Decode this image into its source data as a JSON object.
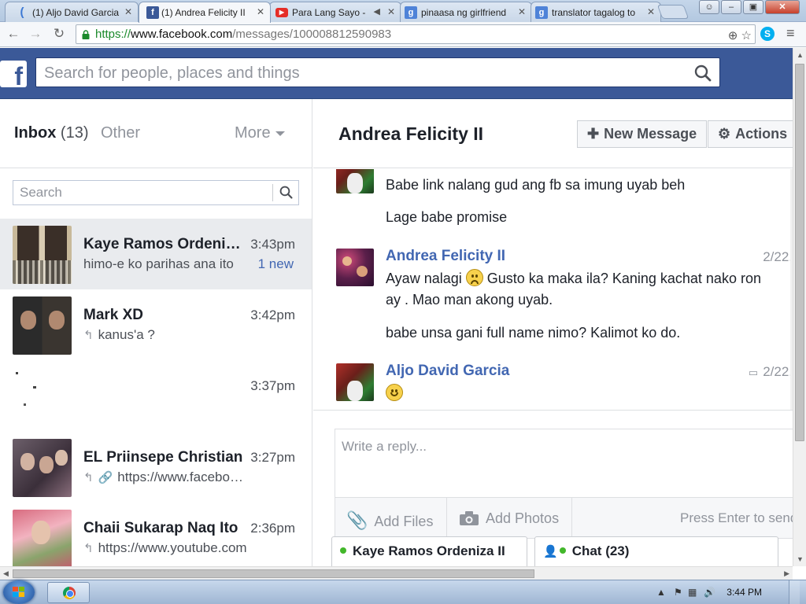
{
  "browser": {
    "tabs": [
      {
        "title": "(1) Aljo David Garcia",
        "favicon": "loading-icon",
        "active": false
      },
      {
        "title": "(1) Andrea Felicity II",
        "favicon": "facebook-icon",
        "active": true
      },
      {
        "title": "Para Lang Sayo - ",
        "favicon": "youtube-icon",
        "active": false
      },
      {
        "title": "pinaasa ng girlfriend",
        "favicon": "google-icon",
        "active": false
      },
      {
        "title": "translator tagalog to",
        "favicon": "google-icon",
        "active": false
      }
    ],
    "url": {
      "scheme": "https://",
      "host": "www.facebook.com",
      "path": "/messages/100008812590983"
    }
  },
  "facebook": {
    "search_placeholder": "Search for people, places and things",
    "brand_color": "#3b5998"
  },
  "inbox": {
    "tab_inbox": "Inbox",
    "inbox_count": "(13)",
    "tab_other": "Other",
    "tab_more": "More",
    "search_placeholder": "Search",
    "conversations": [
      {
        "name": "Kaye Ramos Ordeniza II",
        "time": "3:43pm",
        "snippet": "himo-e ko parihas ana ito",
        "badge": "1 new",
        "selected": true
      },
      {
        "name": "Mark XD",
        "time": "3:42pm",
        "snippet": "kanus'a ?",
        "replied": true
      },
      {
        "name": "",
        "time": "3:37pm",
        "snippet": ""
      },
      {
        "name": "EL Priinsepe Christian",
        "time": "3:27pm",
        "snippet": "https://www.facebook.com",
        "replied": true
      },
      {
        "name": "Chaii Sukarap Naq Ito",
        "time": "2:36pm",
        "snippet": "https://www.youtube.com",
        "replied": true
      }
    ]
  },
  "thread": {
    "title": "Andrea Felicity II",
    "new_message_label": "New Message",
    "actions_label": "Actions",
    "messages": [
      {
        "lines": [
          "Babe link nalang gud ang fb sa imung uyab beh"
        ]
      },
      {
        "lines": [
          "Lage babe promise"
        ]
      },
      {
        "author": "Andrea Felicity II",
        "date": "2/22,",
        "text_before": "Ayaw nalagi",
        "emoji": "sad",
        "text_after": "Gusto ka maka ila? Kaning kachat nako ron ay . Mao man akong uyab."
      },
      {
        "lines": [
          "babe unsa gani full name nimo? Kalimot ko do."
        ]
      },
      {
        "author": "Aljo David Garcia",
        "date": "2/22,",
        "emoji": "smile"
      }
    ],
    "reply_placeholder": "Write a reply...",
    "add_files": "Add Files",
    "add_photos": "Add Photos",
    "enter_hint": "Press Enter to send"
  },
  "chatbar": {
    "open_chat": "Kaye Ramos Ordeniza II",
    "chat_label": "Chat (23)"
  },
  "taskbar": {
    "clock": "3:44 PM"
  }
}
